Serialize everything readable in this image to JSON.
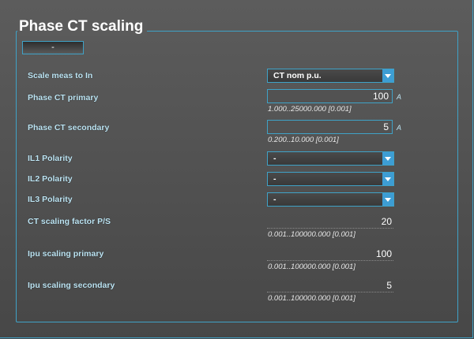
{
  "title": "Phase CT scaling",
  "top_button": "-",
  "rows": {
    "scale_meas": {
      "label": "Scale meas to In",
      "value": "CT nom p.u."
    },
    "ct_primary": {
      "label": "Phase CT primary",
      "value": "100",
      "unit": "A",
      "range": "1.000..25000.000 [0.001]"
    },
    "ct_secondary": {
      "label": "Phase CT secondary",
      "value": "5",
      "unit": "A",
      "range": "0.200..10.000 [0.001]"
    },
    "il1": {
      "label": "IL1 Polarity",
      "value": "-"
    },
    "il2": {
      "label": "IL2 Polarity",
      "value": "-"
    },
    "il3": {
      "label": "IL3 Polarity",
      "value": "-"
    },
    "ct_factor": {
      "label": "CT scaling factor P/S",
      "value": "20",
      "range": "0.001..100000.000 [0.001]"
    },
    "ipu_primary": {
      "label": "Ipu scaling primary",
      "value": "100",
      "range": "0.001..100000.000 [0.001]"
    },
    "ipu_secondary": {
      "label": "Ipu scaling secondary",
      "value": "5",
      "range": "0.001..100000.000 [0.001]"
    }
  }
}
